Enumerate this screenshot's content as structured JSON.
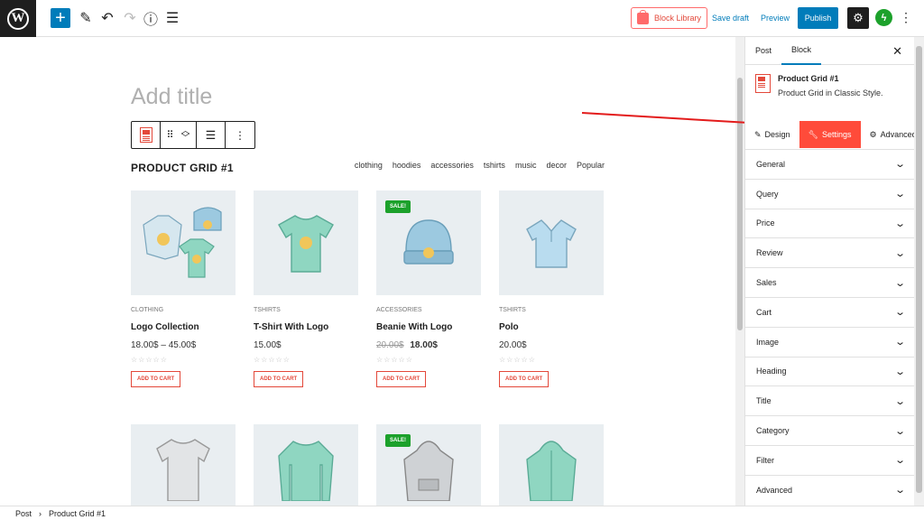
{
  "topbar": {
    "block_library": "Block Library",
    "save_draft": "Save draft",
    "preview": "Preview",
    "publish": "Publish"
  },
  "editor": {
    "title_placeholder": "Add title",
    "grid_title": "PRODUCT GRID #1",
    "filters": [
      "clothing",
      "hoodies",
      "accessories",
      "tshirts",
      "music",
      "decor",
      "Popular"
    ],
    "products": [
      {
        "category": "CLOTHING",
        "name": "Logo Collection",
        "price": "18.00$ – 45.00$",
        "old_price": "",
        "sale": false
      },
      {
        "category": "TSHIRTS",
        "name": "T-Shirt With Logo",
        "price": "15.00$",
        "old_price": "",
        "sale": false
      },
      {
        "category": "ACCESSORIES",
        "name": "Beanie With Logo",
        "price": "18.00$",
        "old_price": "20.00$",
        "sale": true
      },
      {
        "category": "TSHIRTS",
        "name": "Polo",
        "price": "20.00$",
        "old_price": "",
        "sale": false
      }
    ],
    "row2_sale": [
      false,
      false,
      true,
      false
    ],
    "sale_label": "SALE!",
    "add_to_cart": "ADD TO CART",
    "stars": "☆☆☆☆☆"
  },
  "sidebar": {
    "tabs": [
      "Post",
      "Block"
    ],
    "block_name": "Product Grid #1",
    "block_desc": "Product Grid in Classic Style.",
    "sub_tabs": [
      "Design",
      "Settings",
      "Advanced"
    ],
    "sections": [
      "General",
      "Query",
      "Price",
      "Review",
      "Sales",
      "Cart",
      "Image",
      "Heading",
      "Title",
      "Category",
      "Filter",
      "Advanced"
    ]
  },
  "footer": {
    "crumbs": [
      "Post",
      "Product Grid #1"
    ]
  }
}
